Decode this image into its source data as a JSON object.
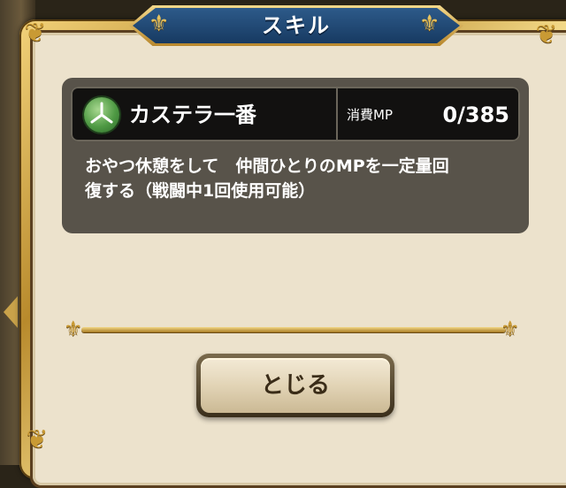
{
  "dialog": {
    "title": "スキル",
    "close_label": "とじる"
  },
  "skill": {
    "name": "カステラ一番",
    "icon": "tri-spoke-orb-icon",
    "mp_label": "消費MP",
    "mp_value": "0/385",
    "description": "おやつ休憩をして　仲間ひとりのMPを一定量回\n復する（戦闘中1回使用可能）"
  },
  "colors": {
    "title_banner": "#1f4a78",
    "frame_gold": "#c99a34",
    "panel": "#ece2cc",
    "skill_box": "#58534a",
    "skill_header": "#121110",
    "icon_green": "#4f9a44"
  }
}
